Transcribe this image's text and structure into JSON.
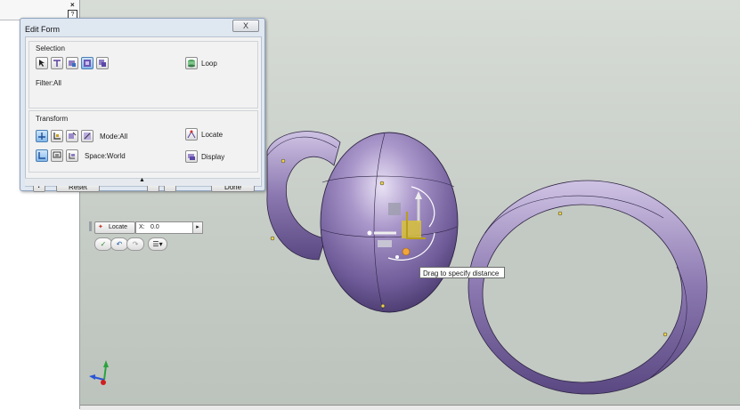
{
  "left_panel": {
    "close_glyph": "×",
    "help_glyph": "?"
  },
  "dialog": {
    "title": "Edit Form",
    "close_glyph": "X",
    "selection": {
      "label": "Selection",
      "filter_text": "Filter:All",
      "loop_label": "Loop",
      "buttons": [
        "select-point-icon",
        "select-edge-icon",
        "select-face-icon",
        "select-body-icon",
        "select-all-icon"
      ]
    },
    "transform": {
      "label": "Transform",
      "mode_text": "Mode:All",
      "space_text": "Space:World",
      "locate_label": "Locate",
      "display_label": "Display"
    },
    "footer": {
      "help_glyph": "?",
      "reset_label": "Reset",
      "undo_glyph": "↶",
      "redo_glyph": "↷",
      "done_label": "Done",
      "collapse_glyph": "▲"
    }
  },
  "mini_toolbar": {
    "locate_label": "Locate",
    "x_label": "X:",
    "x_value": "0.0",
    "arrow_glyph": "▸",
    "ok_glyph": "✓",
    "undo_glyph": "↶",
    "redo_glyph": "↷",
    "menu_glyph": "☰▾"
  },
  "tooltip": {
    "text": "Drag to specify distance"
  },
  "colors": {
    "surface": "#8a78ad",
    "surface_light": "#c9bde0",
    "surface_dark": "#4c3d6f",
    "viewport": "#c8cdc8",
    "accent_blue": "#3b7bd0",
    "manip_yellow": "#d8c23a"
  }
}
